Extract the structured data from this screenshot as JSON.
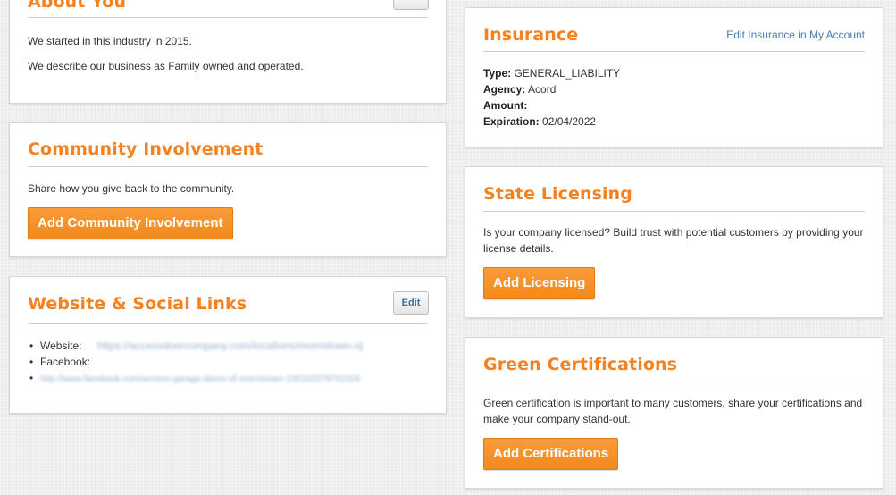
{
  "about": {
    "title": "About You",
    "edit_label": "",
    "lines": [
      "We started in this industry in 2015.",
      "We describe our business as Family owned and operated."
    ]
  },
  "community": {
    "title": "Community Involvement",
    "description": "Share how you give back to the community.",
    "button_label": "Add Community Involvement"
  },
  "website": {
    "title": "Website & Social Links",
    "edit_label": "Edit",
    "items": [
      {
        "label": "Website:",
        "value": "https://accessdoorcompany.com/locations/morristown-nj"
      },
      {
        "label": "Facebook:",
        "value": "http://www.facebook.com/access-garage-doors-of-morristown-100102078761026"
      }
    ]
  },
  "insurance": {
    "title": "Insurance",
    "edit_link": "Edit Insurance in My Account",
    "fields": [
      {
        "label": "Type:",
        "value": "GENERAL_LIABILITY"
      },
      {
        "label": "Agency:",
        "value": "Acord"
      },
      {
        "label": "Amount:",
        "value": ""
      },
      {
        "label": "Expiration:",
        "value": "02/04/2022"
      }
    ]
  },
  "licensing": {
    "title": "State Licensing",
    "description": "Is your company licensed? Build trust with potential customers by providing your license details.",
    "button_label": "Add Licensing"
  },
  "green": {
    "title": "Green Certifications",
    "description": "Green certification is important to many customers, share your certifications and make your company stand-out.",
    "button_label": "Add Certifications"
  }
}
